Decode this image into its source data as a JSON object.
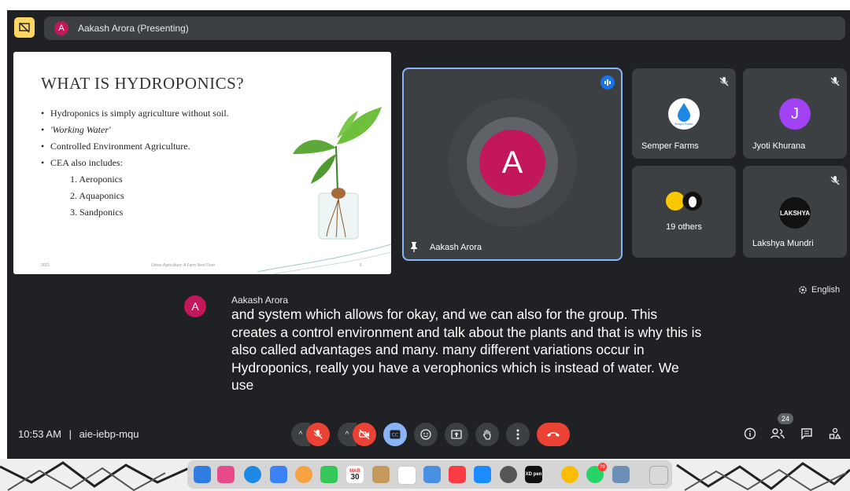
{
  "presenting": {
    "label": "Aakash Arora (Presenting)",
    "avatar_letter": "A"
  },
  "slide": {
    "title": "WHAT IS HYDROPONICS?",
    "bullets": [
      "Hydroponics is simply agriculture without soil.",
      "'Working Water'",
      "Controlled Environment Agriculture.",
      "CEA also includes:"
    ],
    "sublist": [
      "1. Aeroponics",
      "2. Aquaponics",
      "3. Sandponics"
    ],
    "footer_year": "2021",
    "footer_title": "Urban Agriculture: A Farm Next Door",
    "page_number": "6"
  },
  "main_tile": {
    "name": "Aakash Arora",
    "avatar_letter": "A"
  },
  "participants": [
    {
      "name": "Semper Farms",
      "logo_text": "Semper Farms"
    },
    {
      "name": "Jyoti Khurana",
      "avatar_letter": "J"
    },
    {
      "name": "19 others"
    },
    {
      "name": "Lakshya Mundri",
      "logo_text": "LAKSHYA"
    }
  ],
  "caption": {
    "avatar_letter": "A",
    "speaker": "Aakash Arora",
    "text": "and system which allows for okay, and we can also for the group. This creates a control environment and talk about the plants and that is why this is also called advantages and many. many different variations occur in Hydroponics, really you have a verophonics which is instead of water. We use"
  },
  "language": "English",
  "meeting": {
    "time": "10:53 AM",
    "separator": "|",
    "code": "aie-iebp-mqu"
  },
  "people_count": "24",
  "dock": {
    "calendar_month": "MAR",
    "calendar_day": "30",
    "whatsapp_badge": "29",
    "xd_label": "XD pen"
  },
  "colors": {
    "background": "#202124",
    "tile": "#3c4043",
    "accent": "#8ab4f8",
    "end_call": "#ea4335",
    "avatar": "#c2185b"
  }
}
